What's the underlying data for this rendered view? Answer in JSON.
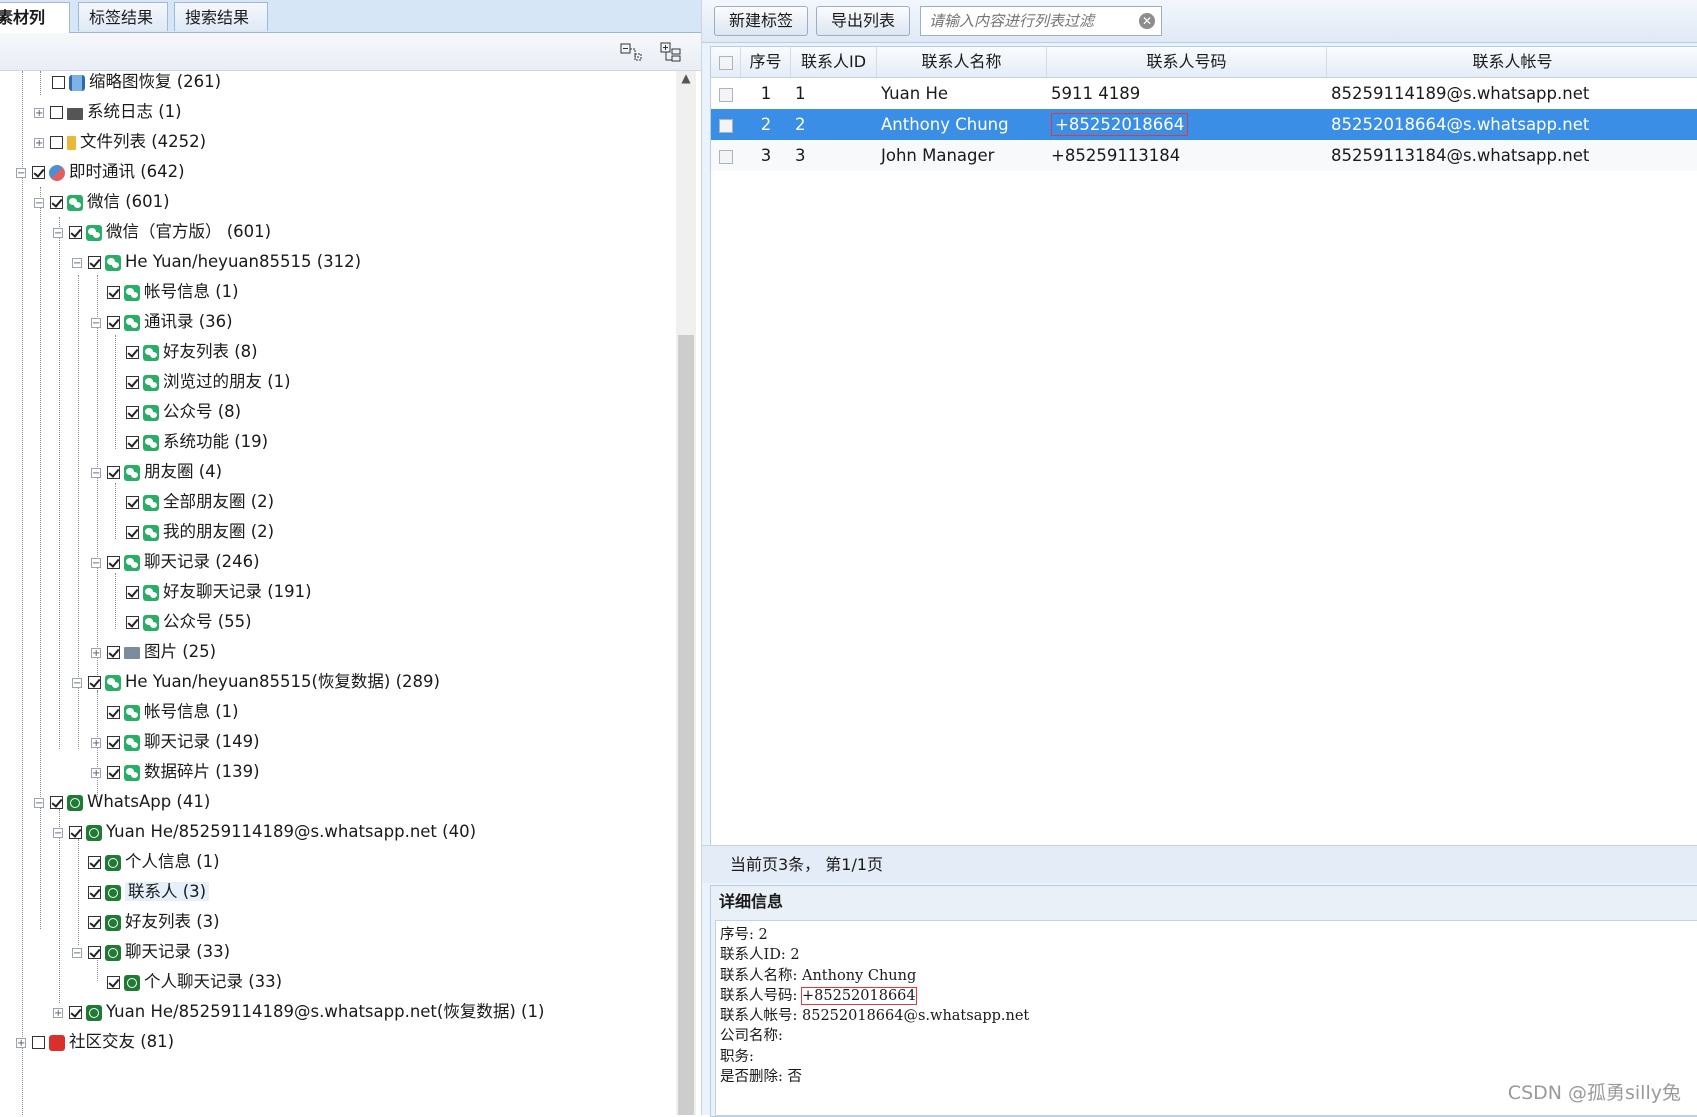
{
  "tabs": [
    {
      "label": "素材列表",
      "active": true
    },
    {
      "label": "标签结果",
      "active": false
    },
    {
      "label": "搜索结果",
      "active": false
    }
  ],
  "tree": [
    {
      "label": "缩略图恢复 (261)",
      "icon": "film-icon",
      "checked": false,
      "expander": "none",
      "depth": 2
    },
    {
      "label": "系统日志 (1)",
      "icon": "log-icon",
      "checked": false,
      "expander": "plus",
      "depth": 2
    },
    {
      "label": "文件列表 (4252)",
      "icon": "folder-icon",
      "checked": false,
      "expander": "plus",
      "depth": 2
    },
    {
      "label": "即时通讯 (642)",
      "icon": "im-icon",
      "checked": true,
      "expander": "minus",
      "depth": 1
    },
    {
      "label": "微信 (601)",
      "icon": "wechat-icon",
      "checked": true,
      "expander": "minus",
      "depth": 2
    },
    {
      "label": "微信（官方版） (601)",
      "icon": "wechat-icon",
      "checked": true,
      "expander": "minus",
      "depth": 3
    },
    {
      "label": "He Yuan/heyuan85515 (312)",
      "icon": "wechat-icon",
      "checked": true,
      "expander": "minus",
      "depth": 4
    },
    {
      "label": "帐号信息 (1)",
      "icon": "wechat-icon",
      "checked": true,
      "expander": "none",
      "depth": 5
    },
    {
      "label": "通讯录 (36)",
      "icon": "wechat-icon",
      "checked": true,
      "expander": "minus",
      "depth": 5
    },
    {
      "label": "好友列表 (8)",
      "icon": "wechat-icon",
      "checked": true,
      "expander": "none",
      "depth": 6
    },
    {
      "label": "浏览过的朋友 (1)",
      "icon": "wechat-icon",
      "checked": true,
      "expander": "none",
      "depth": 6
    },
    {
      "label": "公众号 (8)",
      "icon": "wechat-icon",
      "checked": true,
      "expander": "none",
      "depth": 6
    },
    {
      "label": "系统功能 (19)",
      "icon": "wechat-icon",
      "checked": true,
      "expander": "none",
      "depth": 6
    },
    {
      "label": "朋友圈 (4)",
      "icon": "wechat-icon",
      "checked": true,
      "expander": "minus",
      "depth": 5
    },
    {
      "label": "全部朋友圈 (2)",
      "icon": "wechat-icon",
      "checked": true,
      "expander": "none",
      "depth": 6
    },
    {
      "label": "我的朋友圈 (2)",
      "icon": "wechat-icon",
      "checked": true,
      "expander": "none",
      "depth": 6
    },
    {
      "label": "聊天记录 (246)",
      "icon": "wechat-icon",
      "checked": true,
      "expander": "minus",
      "depth": 5
    },
    {
      "label": "好友聊天记录 (191)",
      "icon": "wechat-icon",
      "checked": true,
      "expander": "none",
      "depth": 6
    },
    {
      "label": "公众号 (55)",
      "icon": "wechat-icon",
      "checked": true,
      "expander": "none",
      "depth": 6
    },
    {
      "label": "图片 (25)",
      "icon": "picture-icon",
      "checked": true,
      "expander": "plus",
      "depth": 5
    },
    {
      "label": "He Yuan/heyuan85515(恢复数据) (289)",
      "icon": "wechat-icon",
      "checked": true,
      "expander": "minus",
      "depth": 4
    },
    {
      "label": "帐号信息 (1)",
      "icon": "wechat-icon",
      "checked": true,
      "expander": "none",
      "depth": 5
    },
    {
      "label": "聊天记录 (149)",
      "icon": "wechat-icon",
      "checked": true,
      "expander": "plus",
      "depth": 5
    },
    {
      "label": "数据碎片 (139)",
      "icon": "wechat-icon",
      "checked": true,
      "expander": "plus",
      "depth": 5
    },
    {
      "label": "WhatsApp (41)",
      "icon": "whatsapp-icon",
      "checked": true,
      "expander": "minus",
      "depth": 2
    },
    {
      "label": "Yuan He/85259114189@s.whatsapp.net (40)",
      "icon": "whatsapp-icon",
      "checked": true,
      "expander": "minus",
      "depth": 3
    },
    {
      "label": "个人信息 (1)",
      "icon": "whatsapp-icon",
      "checked": true,
      "expander": "none",
      "depth": 4
    },
    {
      "label": "联系人 (3)",
      "icon": "whatsapp-icon",
      "checked": true,
      "expander": "none",
      "depth": 4,
      "selected": true
    },
    {
      "label": "好友列表 (3)",
      "icon": "whatsapp-icon",
      "checked": true,
      "expander": "none",
      "depth": 4
    },
    {
      "label": "聊天记录 (33)",
      "icon": "whatsapp-icon",
      "checked": true,
      "expander": "minus",
      "depth": 4
    },
    {
      "label": "个人聊天记录 (33)",
      "icon": "whatsapp-icon",
      "checked": true,
      "expander": "none",
      "depth": 5
    },
    {
      "label": "Yuan He/85259114189@s.whatsapp.net(恢复数据) (1)",
      "icon": "whatsapp-icon",
      "checked": true,
      "expander": "plus",
      "depth": 3
    },
    {
      "label": "社区交友 (81)",
      "icon": "social-icon",
      "checked": false,
      "expander": "plus",
      "depth": 1
    }
  ],
  "toolbar": {
    "new_tag": "新建标签",
    "export_list": "导出列表",
    "filter_placeholder": "请输入内容进行列表过滤"
  },
  "grid": {
    "columns": [
      "序号",
      "联系人ID",
      "联系人名称",
      "联系人号码",
      "联系人帐号"
    ],
    "rows": [
      {
        "seq": "1",
        "id": "1",
        "name": "Yuan He",
        "number": "5911 4189",
        "account": "85259114189@s.whatsapp.net"
      },
      {
        "seq": "2",
        "id": "2",
        "name": "Anthony Chung",
        "number": "+85252018664",
        "account": "85252018664@s.whatsapp.net",
        "selected": true
      },
      {
        "seq": "3",
        "id": "3",
        "name": "John Manager",
        "number": "+85259113184",
        "account": "85259113184@s.whatsapp.net"
      }
    ]
  },
  "pager": "当前页3条， 第1/1页",
  "detail": {
    "title": "详细信息",
    "lines": [
      {
        "label": "序号: ",
        "value": "2"
      },
      {
        "label": "联系人ID: ",
        "value": "2"
      },
      {
        "label": "联系人名称: ",
        "value": "Anthony Chung"
      },
      {
        "label": "联系人号码: ",
        "value": "+85252018664",
        "highlight": true
      },
      {
        "label": "联系人帐号: ",
        "value": "85252018664@s.whatsapp.net"
      },
      {
        "label": "公司名称: ",
        "value": ""
      },
      {
        "label": "职务: ",
        "value": ""
      },
      {
        "label": "是否删除: ",
        "value": "否"
      }
    ]
  },
  "watermark": "CSDN @孤勇silly兔",
  "colors": {
    "selection": "#3a8ee6",
    "highlight_box": "#e23a3a",
    "wechat": "#2aae67",
    "whatsapp": "#1f7a34"
  }
}
